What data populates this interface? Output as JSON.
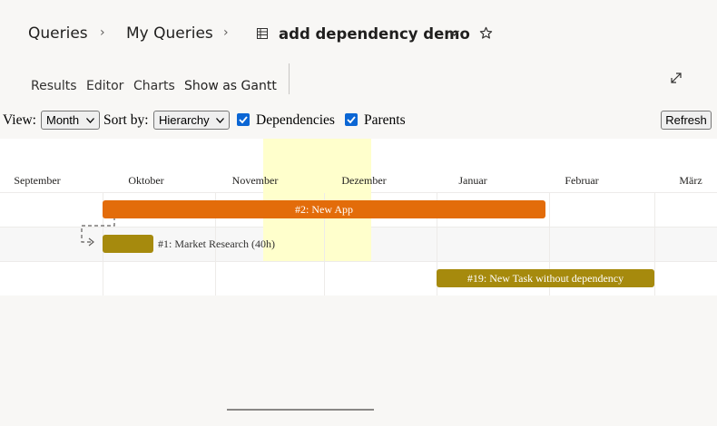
{
  "breadcrumb": {
    "items": [
      "Queries",
      "My Queries"
    ],
    "separator": "›",
    "title": "add dependency demo"
  },
  "icons": {
    "query": "grid-table-icon",
    "dropdown": "chevron-down-icon",
    "favorite": "star-icon",
    "expand": "expand-diagonal-icon"
  },
  "tabs": [
    {
      "label": "Results",
      "active": false
    },
    {
      "label": "Editor",
      "active": false
    },
    {
      "label": "Charts",
      "active": false
    },
    {
      "label": "Show as Gantt",
      "active": true
    }
  ],
  "controls": {
    "view_label": "View:",
    "view_value": "Month",
    "sort_label": "Sort by:",
    "sort_value": "Hierarchy",
    "dependencies_label": "Dependencies",
    "dependencies_checked": true,
    "parents_label": "Parents",
    "parents_checked": true,
    "refresh_label": "Refresh"
  },
  "gantt": {
    "months": [
      "September",
      "Oktober",
      "November",
      "Dezember",
      "Januar",
      "Februar",
      "März"
    ],
    "tasks": [
      {
        "label": "#2: New App",
        "color": "#e36c0a",
        "label_inside": true
      },
      {
        "label": "#1: Market Research (40h)",
        "color": "#a68a0d",
        "label_inside": false
      },
      {
        "label": "#19: New Task without dependency",
        "color": "#a68a0d",
        "label_inside": true
      }
    ],
    "highlight_color": "#ffffcc",
    "checkbox_color": "#0b66d4"
  }
}
